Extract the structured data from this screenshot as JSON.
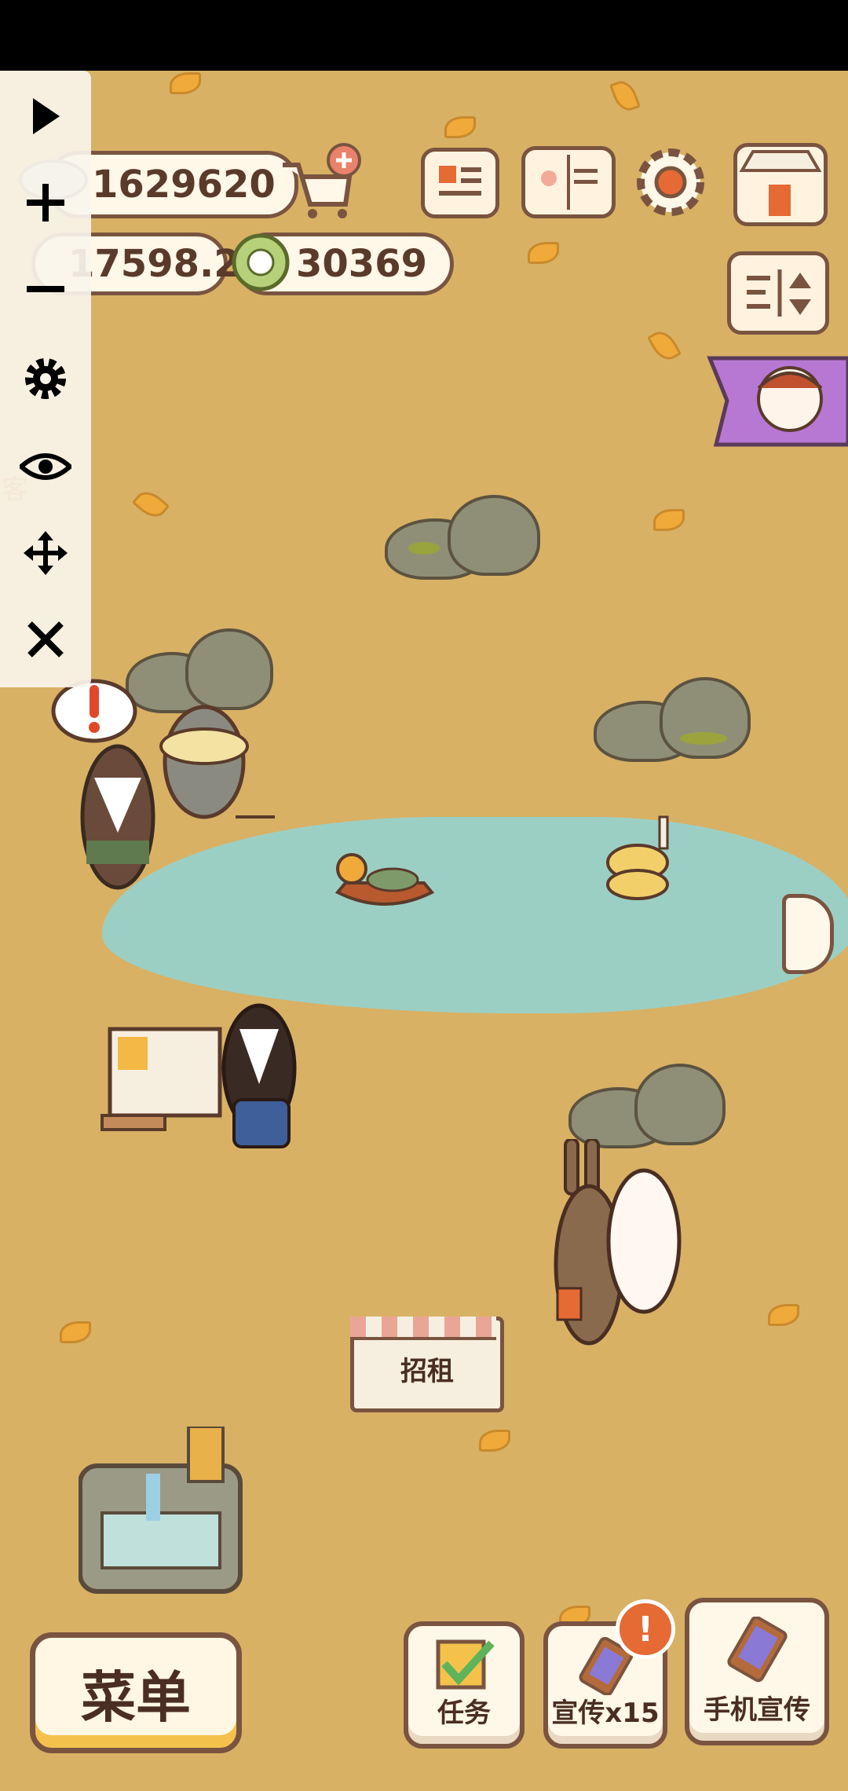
{
  "hud": {
    "fish_count": "1629620",
    "star_count": "17598.2",
    "coin_count": "30369"
  },
  "side_label": "客",
  "sign": {
    "label": "招租"
  },
  "bottom": {
    "menu_label": "菜单",
    "tasks_label": "任务",
    "promote_label": "宣传x15",
    "phone_promote_label": "手机宣传",
    "alert_badge": "!"
  },
  "icons": {
    "toolbar": [
      "play-icon",
      "plus-icon",
      "minus-icon",
      "gear-icon",
      "eye-icon",
      "move-icon",
      "close-icon"
    ],
    "top": [
      "cart-add-icon",
      "newspaper-icon",
      "book-icon",
      "settings-icon",
      "shop-icon",
      "sort-icon",
      "portrait-flag-icon"
    ]
  },
  "colors": {
    "ground": "#d8b165",
    "pond": "#9ccfc3",
    "outline": "#7a5440",
    "badge": "#e56a33",
    "menu_accent": "#f4c24b"
  }
}
